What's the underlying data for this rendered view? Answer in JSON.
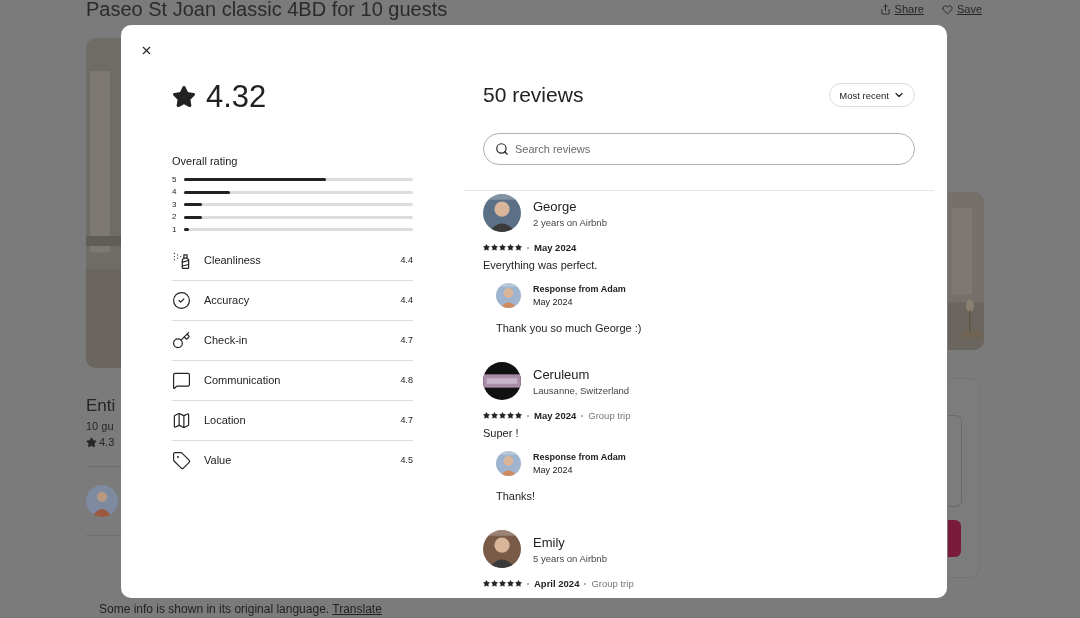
{
  "page": {
    "title": "Paseo St Joan classic 4BD for 10 guests",
    "share": "Share",
    "save": "Save",
    "listing_heading": "Enti",
    "listing_guests": "10 gu",
    "listing_rating": "4.3",
    "footer": {
      "text": "Some info is shown in its original language.",
      "link": "Translate"
    }
  },
  "modal": {
    "rating": "4.32",
    "overall_label": "Overall rating",
    "distribution": [
      {
        "label": "5",
        "level": 0.62
      },
      {
        "label": "4",
        "level": 0.2
      },
      {
        "label": "3",
        "level": 0.08
      },
      {
        "label": "2",
        "level": 0.08
      },
      {
        "label": "1",
        "level": 0.02
      }
    ],
    "categories": [
      {
        "kind": "cleanliness",
        "label": "Cleanliness",
        "value": "4.4"
      },
      {
        "kind": "accuracy",
        "label": "Accuracy",
        "value": "4.4"
      },
      {
        "kind": "checkin",
        "label": "Check-in",
        "value": "4.7"
      },
      {
        "kind": "communication",
        "label": "Communication",
        "value": "4.8"
      },
      {
        "kind": "location",
        "label": "Location",
        "value": "4.7"
      },
      {
        "kind": "value",
        "label": "Value",
        "value": "4.5"
      }
    ],
    "reviews_title": "50 reviews",
    "sort": "Most recent",
    "search": {
      "placeholder": "Search reviews"
    },
    "reviews": [
      {
        "name": "George",
        "subtitle": "2 years on Airbnb",
        "stars": 5,
        "date": "May 2024",
        "text": "Everything was perfect.",
        "response": {
          "title": "Response from Adam",
          "date": "May 2024",
          "text": "Thank you so much George :)"
        }
      },
      {
        "name": "Ceruleum",
        "subtitle": "Lausanne, Switzerland",
        "stars": 5,
        "date": "May 2024",
        "trip": "Group trip",
        "text": "Super !",
        "response": {
          "title": "Response from Adam",
          "date": "May 2024",
          "text": "Thanks!"
        }
      },
      {
        "name": "Emily",
        "subtitle": "5 years on Airbnb",
        "stars": 5,
        "date": "April 2024",
        "trip": "Group trip"
      }
    ]
  }
}
